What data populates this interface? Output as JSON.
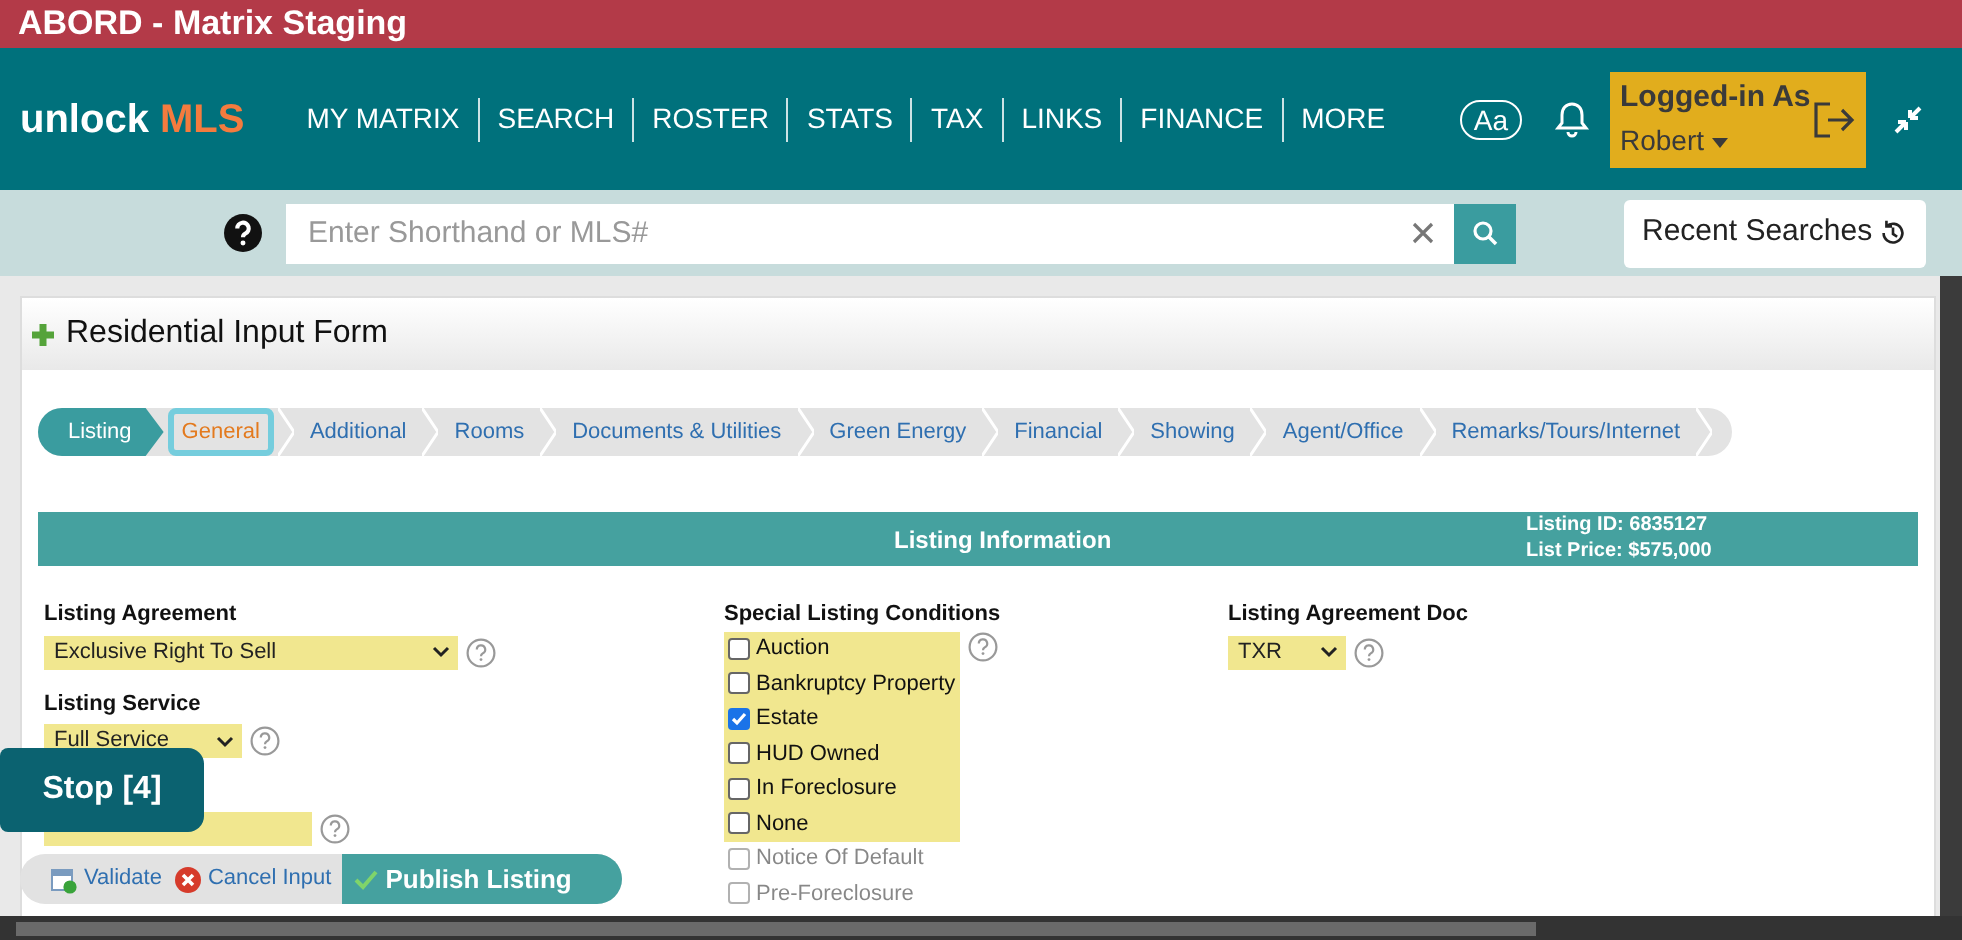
{
  "window": {
    "title": "ABORD - Matrix Staging"
  },
  "header": {
    "logo_word": "unlock",
    "logo_brand": "MLS",
    "nav": [
      "MY MATRIX",
      "SEARCH",
      "ROSTER",
      "STATS",
      "TAX",
      "LINKS",
      "FINANCE",
      "MORE"
    ],
    "font_button": "Aa",
    "user": {
      "heading": "Logged-in As",
      "name": "Robert"
    }
  },
  "search": {
    "placeholder": "Enter Shorthand or MLS#",
    "recent": "Recent Searches"
  },
  "form": {
    "title": "Residential Input Form",
    "steps": [
      {
        "label": "Listing",
        "selected": false,
        "completed": true
      },
      {
        "label": "General",
        "selected": true,
        "completed": false
      },
      {
        "label": "Additional",
        "selected": false,
        "completed": false
      },
      {
        "label": "Rooms",
        "selected": false,
        "completed": false
      },
      {
        "label": "Documents & Utilities",
        "selected": false,
        "completed": false
      },
      {
        "label": "Green Energy",
        "selected": false,
        "completed": false
      },
      {
        "label": "Financial",
        "selected": false,
        "completed": false
      },
      {
        "label": "Showing",
        "selected": false,
        "completed": false
      },
      {
        "label": "Agent/Office",
        "selected": false,
        "completed": false
      },
      {
        "label": "Remarks/Tours/Internet",
        "selected": false,
        "completed": false
      }
    ],
    "section": {
      "title": "Listing Information",
      "listing_id": "Listing ID: 6835127",
      "list_price": "List Price: $575,000"
    },
    "fields": [
      {
        "label": "Listing Agreement",
        "value": "Exclusive Right To Sell"
      },
      {
        "label": "Listing Service",
        "value": "Full Service"
      }
    ],
    "conditions": {
      "label": "Special Listing Conditions",
      "items": [
        {
          "label": "Auction",
          "checked": false,
          "faded": false
        },
        {
          "label": "Bankruptcy Property",
          "checked": false,
          "faded": false
        },
        {
          "label": "Estate",
          "checked": true,
          "faded": false
        },
        {
          "label": "HUD Owned",
          "checked": false,
          "faded": false
        },
        {
          "label": "In Foreclosure",
          "checked": false,
          "faded": false
        },
        {
          "label": "None",
          "checked": false,
          "faded": false
        },
        {
          "label": "Notice Of Default",
          "checked": false,
          "faded": true
        },
        {
          "label": "Pre-Foreclosure",
          "checked": false,
          "faded": true
        }
      ]
    },
    "agreement_doc": {
      "label": "Listing Agreement Doc",
      "value": "TXR"
    }
  },
  "stop_badge": "Stop [4]",
  "toolbar": {
    "validate": "Validate",
    "cancel": "Cancel Input",
    "publish": "Publish Listing"
  }
}
